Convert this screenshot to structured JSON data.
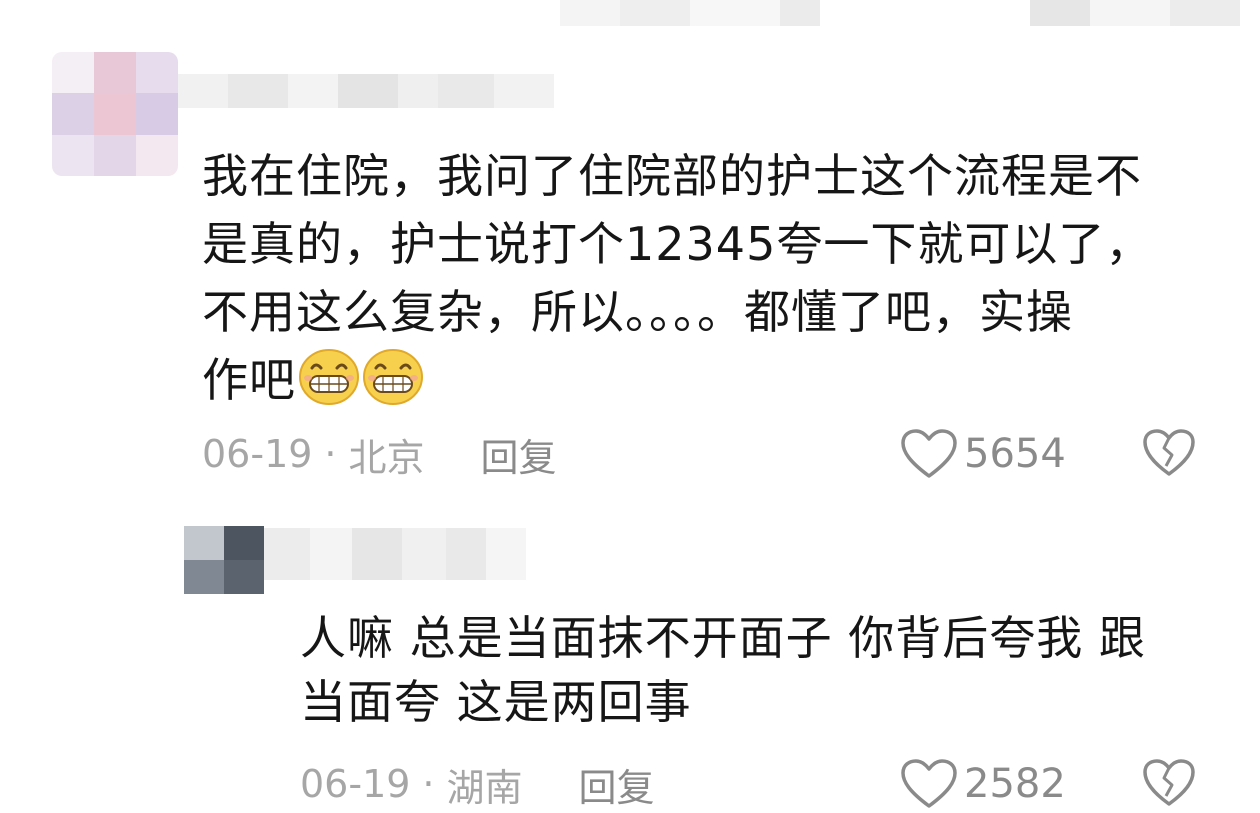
{
  "top_blur_colors": [
    "#f4f4f4",
    "#eeeeee",
    "#f7f7f7",
    "#ebebeb",
    "#f2f2f2",
    "#e6e6e6",
    "#f5f5f5",
    "#ececec"
  ],
  "comment1": {
    "avatar_colors": [
      "#dcd0e6",
      "#e8c8d6",
      "#cfc4e0",
      "#f0d4de",
      "#d7cbe5",
      "#e3ccd9",
      "#ece4f0",
      "#dbcde6",
      "#f3e8ef"
    ],
    "text_lines": [
      "我在住院，我问了住院部的护士这个流程是不",
      "是真的，护士说打个12345夸一下就可以了，",
      "不用这么复杂，所以。。。。都懂了吧，实操",
      "作吧"
    ],
    "emoji": [
      "grin-emoji",
      "grin-emoji"
    ],
    "date": "06-19",
    "separator": "·",
    "location": "北京",
    "reply_label": "回复",
    "like_icon": "heart-outline-icon",
    "like_count": "5654",
    "dislike_icon": "broken-heart-icon"
  },
  "comment2": {
    "avatar_colors": [
      "#7f8893",
      "#4d5560",
      "#c2c7cd",
      "#5a636e"
    ],
    "text_lines": [
      "人嘛 总是当面抹不开面子 你背后夸我 跟",
      "当面夸 这是两回事"
    ],
    "date": "06-19",
    "separator": "·",
    "location": "湖南",
    "reply_label": "回复",
    "like_icon": "heart-outline-icon",
    "like_count": "2582",
    "dislike_icon": "broken-heart-icon"
  },
  "colors": {
    "text": "#161616",
    "meta": "#a6a6a6",
    "icon": "#8a8a8a",
    "emoji_face": "#f7d04e"
  }
}
